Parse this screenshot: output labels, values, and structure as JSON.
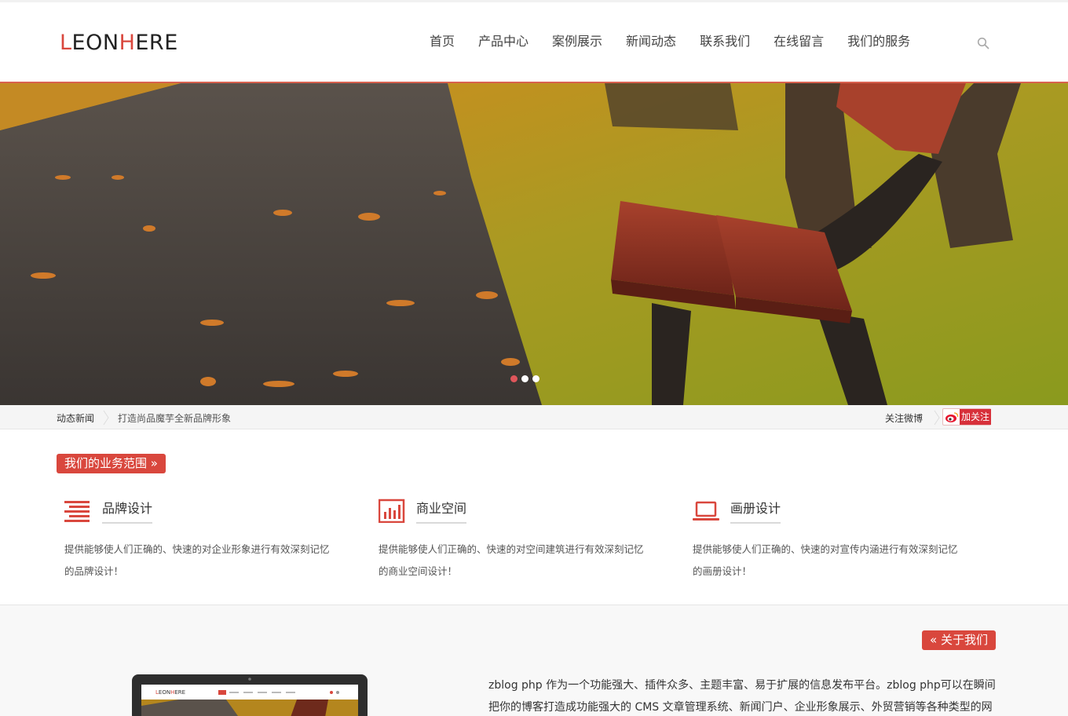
{
  "brand": {
    "logo_prefix_red": "L",
    "logo_middle": "EON",
    "logo_red": "H",
    "logo_suffix": "ERE",
    "accent_color": "#d9473d"
  },
  "nav": {
    "items": [
      "首页",
      "产品中心",
      "案例展示",
      "新闻动态",
      "联系我们",
      "在线留言",
      "我们的服务"
    ],
    "search_icon": "search-icon"
  },
  "banner": {
    "slides_count": 3,
    "active_slide": 1
  },
  "ticker": {
    "label": "动态新闻",
    "headline": "打造尚品魔芋全新品牌形象",
    "follow_label": "关注微博",
    "follow_button": "加关注"
  },
  "services": {
    "title": "我们的业务范围 »",
    "items": [
      {
        "name": "品牌设计",
        "icon": "list-lines-icon",
        "desc": "提供能够使人们正确的、快速的对企业形象进行有效深刻记忆的品牌设计！"
      },
      {
        "name": "商业空间",
        "icon": "bar-chart-icon",
        "desc": "提供能够使人们正确的、快速的对空间建筑进行有效深刻记忆的商业空间设计！"
      },
      {
        "name": "画册设计",
        "icon": "laptop-icon",
        "desc": "提供能够使人们正确的、快速的对宣传内涵进行有效深刻记忆的画册设计！"
      }
    ]
  },
  "about": {
    "button": "« 关于我们",
    "text": "zblog php 作为一个功能强大、插件众多、主题丰富、易于扩展的信息发布平台。zblog php可以在瞬间把你的博客打造成功能强大的 CMS 文章管理系统、新闻门户、企业形象展示、外贸营销等各种类型的网"
  }
}
